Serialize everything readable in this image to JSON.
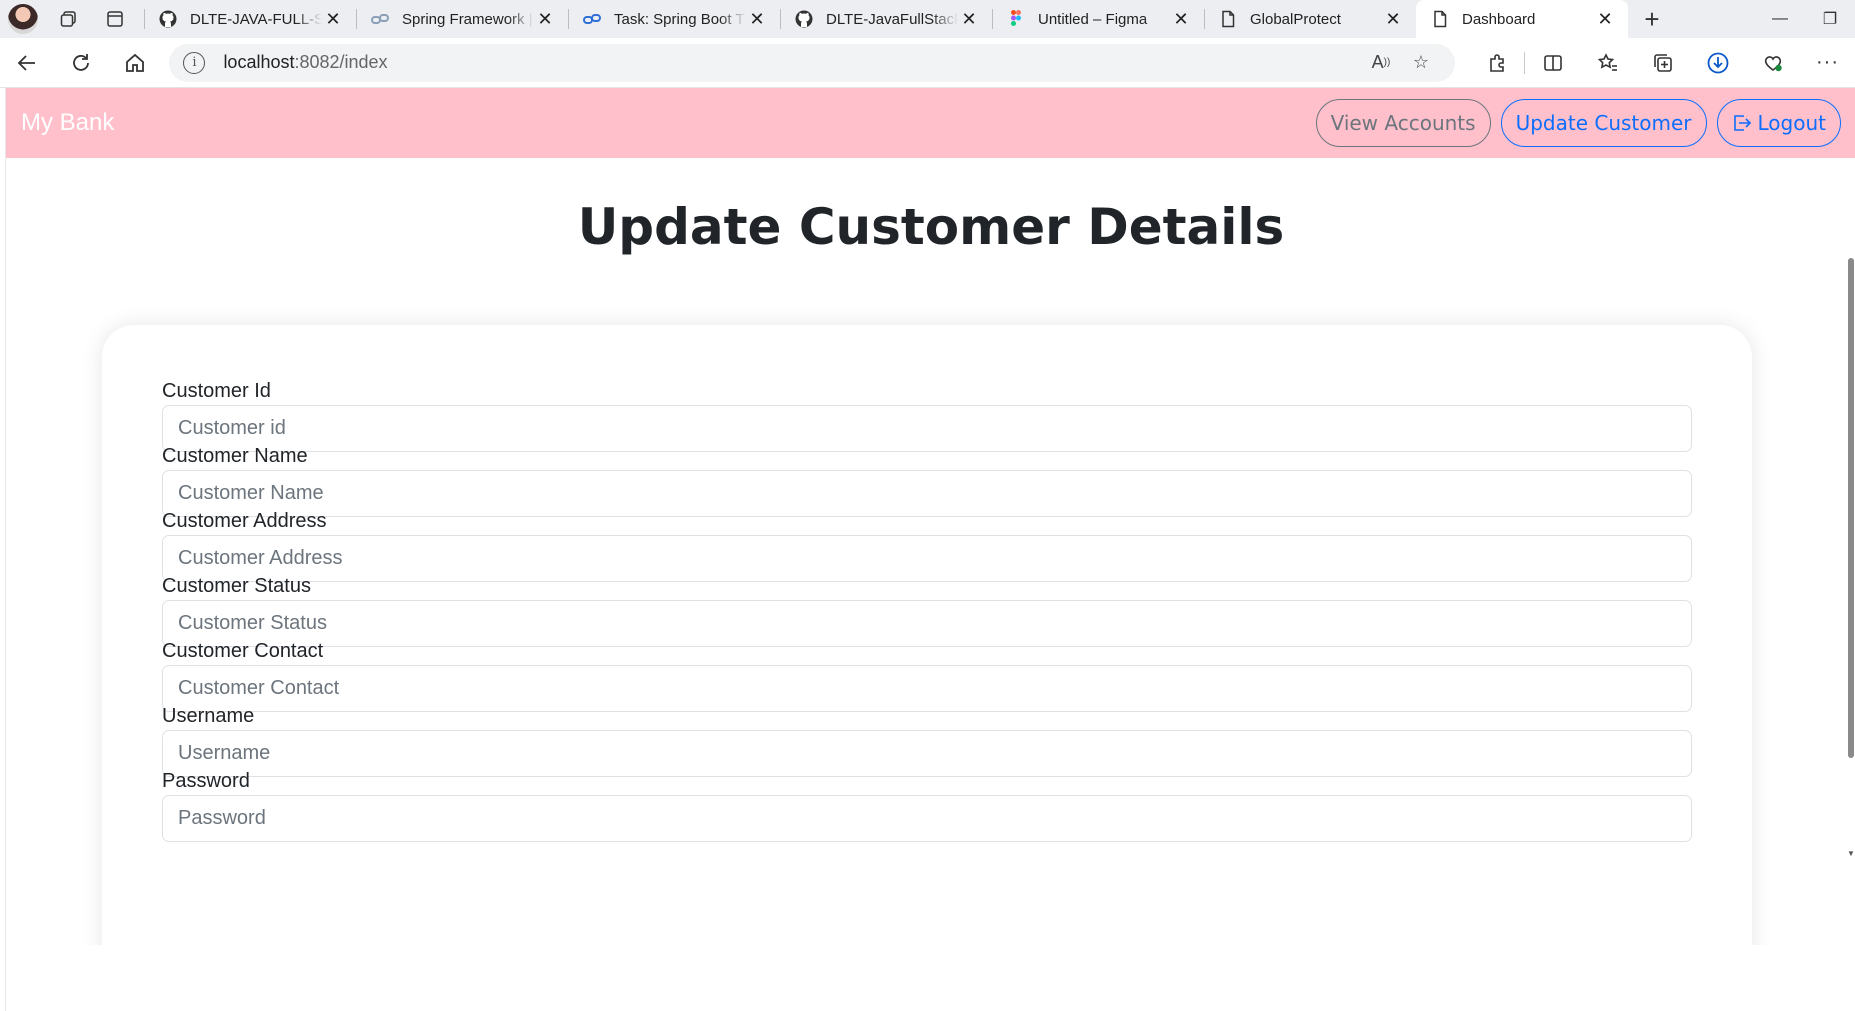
{
  "browser": {
    "tabs": [
      {
        "title": "DLTE-JAVA-FULL-ST",
        "icon": "github-icon"
      },
      {
        "title": "Spring Framework |",
        "icon": "spring-link-icon"
      },
      {
        "title": "Task: Spring Boot Th",
        "icon": "spring-link-icon"
      },
      {
        "title": "DLTE-JavaFullStack-",
        "icon": "github-icon"
      },
      {
        "title": "Untitled – Figma",
        "icon": "figma-icon"
      },
      {
        "title": "GlobalProtect",
        "icon": "page-icon"
      },
      {
        "title": "Dashboard",
        "icon": "page-icon",
        "active": true
      }
    ],
    "url_host": "localhost",
    "url_rest": ":8082/index"
  },
  "navbar": {
    "brand": "My Bank",
    "view_accounts": "View Accounts",
    "update_customer": "Update Customer",
    "logout": "Logout",
    "bg_color": "#ffc0cb"
  },
  "page": {
    "title": "Update Customer Details"
  },
  "form": {
    "fields": [
      {
        "label": "Customer Id",
        "placeholder": "Customer id"
      },
      {
        "label": "Customer Name",
        "placeholder": "Customer Name"
      },
      {
        "label": "Customer Address",
        "placeholder": "Customer Address"
      },
      {
        "label": "Customer Status",
        "placeholder": "Customer Status"
      },
      {
        "label": "Customer Contact",
        "placeholder": "Customer Contact"
      },
      {
        "label": "Username",
        "placeholder": "Username"
      },
      {
        "label": "Password",
        "placeholder": "Password"
      }
    ]
  },
  "colors": {
    "primary": "#0d6efd",
    "secondary": "#6c757d"
  }
}
